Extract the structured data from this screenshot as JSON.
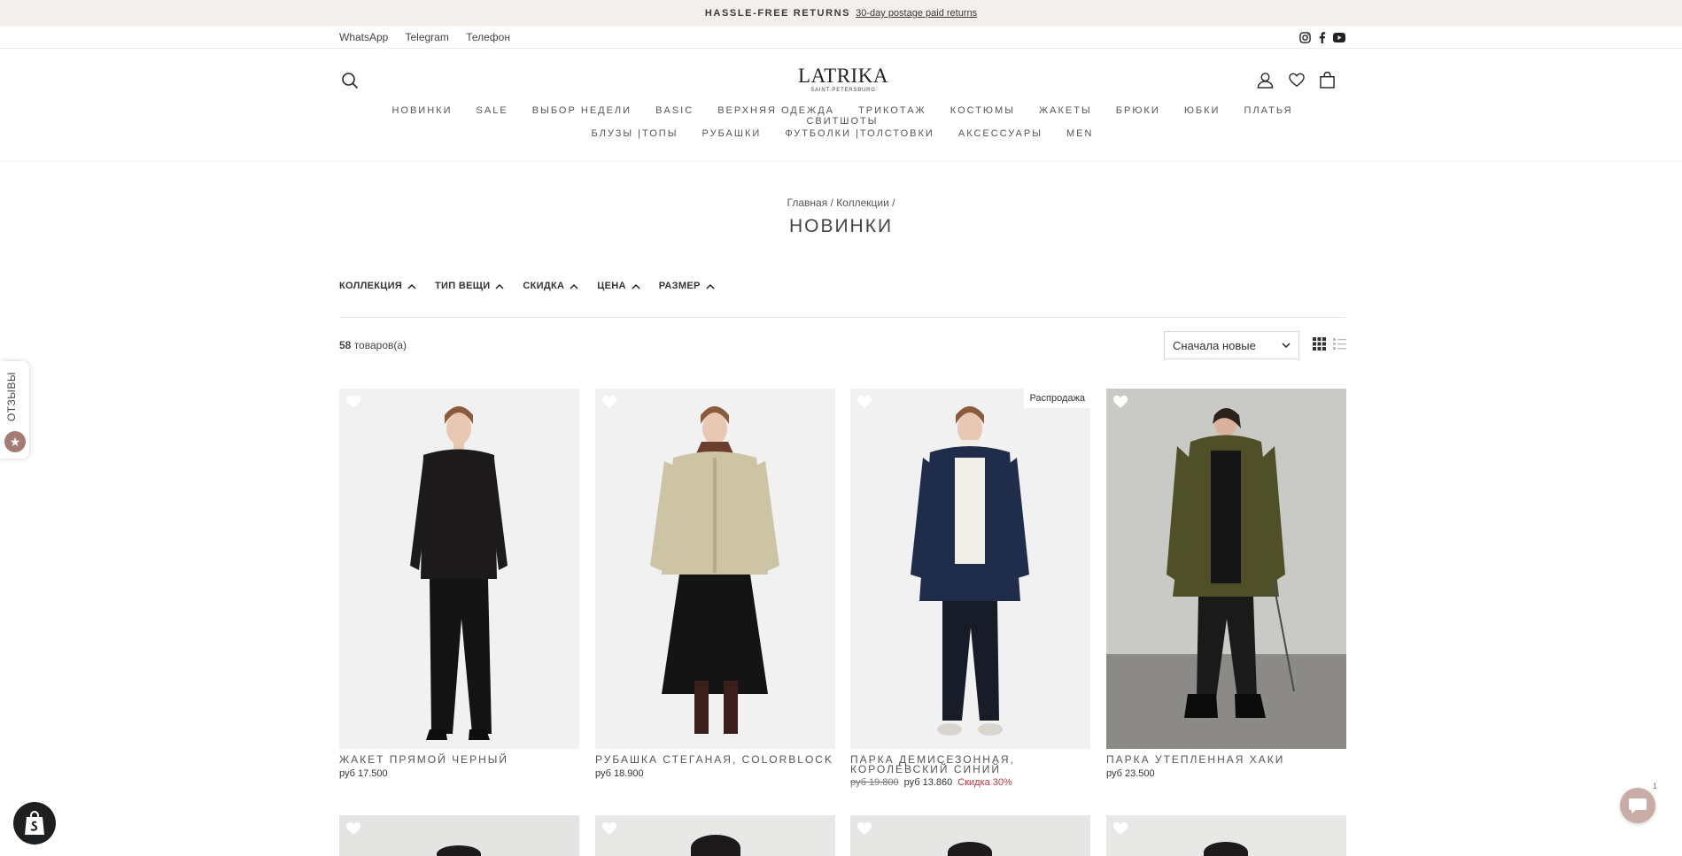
{
  "announcement": {
    "strong": "HASSLE-FREE RETURNS",
    "link": "30-day postage paid returns"
  },
  "util": {
    "links": [
      "WhatsApp",
      "Telegram",
      "Телефон"
    ],
    "social_icons": [
      "instagram-icon",
      "facebook-icon",
      "youtube-icon"
    ]
  },
  "logo": {
    "main": "LATRIKA",
    "sub": "SAINT-PETERSBURG"
  },
  "nav": {
    "row1": [
      "НОВИНКИ",
      "SALE",
      "ВЫБОР НЕДЕЛИ",
      "BASIC",
      "ВЕРХНЯЯ ОДЕЖДА",
      "ТРИКОТАЖ",
      "КОСТЮМЫ",
      "ЖАКЕТЫ",
      "БРЮКИ",
      "ЮБКИ",
      "ПЛАТЬЯ",
      "СВИТШОТЫ"
    ],
    "row2": [
      "БЛУЗЫ |ТОПЫ",
      "РУБАШКИ",
      "ФУТБОЛКИ |ТОЛСТОВКИ",
      "АКСЕССУАРЫ",
      "MEN"
    ]
  },
  "breadcrumb": "Главная / Коллекции /",
  "page_title": "НОВИНКИ",
  "filters": [
    "КОЛЛЕКЦИЯ",
    "ТИП ВЕЩИ",
    "СКИДКА",
    "ЦЕНА",
    "РАЗМЕР"
  ],
  "count": {
    "number": "58",
    "suffix": " товаров(а)"
  },
  "sort": {
    "selected": "Сначала новые"
  },
  "products": [
    {
      "name": "ЖАКЕТ ПРЯМОЙ ЧЕРНЫЙ",
      "price": "руб 17.500",
      "badge": "",
      "old_price": "",
      "discount": ""
    },
    {
      "name": "РУБАШКА СТЕГАНАЯ, COLORBLOCK",
      "price": "руб 18.900",
      "badge": "",
      "old_price": "",
      "discount": ""
    },
    {
      "name": "ПАРКА ДЕМИСЕЗОННАЯ, КОРОЛЕВСКИЙ СИНИЙ",
      "price": "руб 13.860",
      "badge": "Распродажа",
      "old_price": "руб 19.800",
      "discount": "Скидка 30%"
    },
    {
      "name": "ПАРКА УТЕПЛЕННАЯ ХАКИ",
      "price": "руб 23.500",
      "badge": "",
      "old_price": "",
      "discount": ""
    }
  ],
  "reviews_tab": "ОТЗЫВЫ",
  "chat_badge": "1",
  "colors": {
    "accent": "#a47c73",
    "sale": "#c4343e",
    "announce_bg": "#f3efec"
  }
}
